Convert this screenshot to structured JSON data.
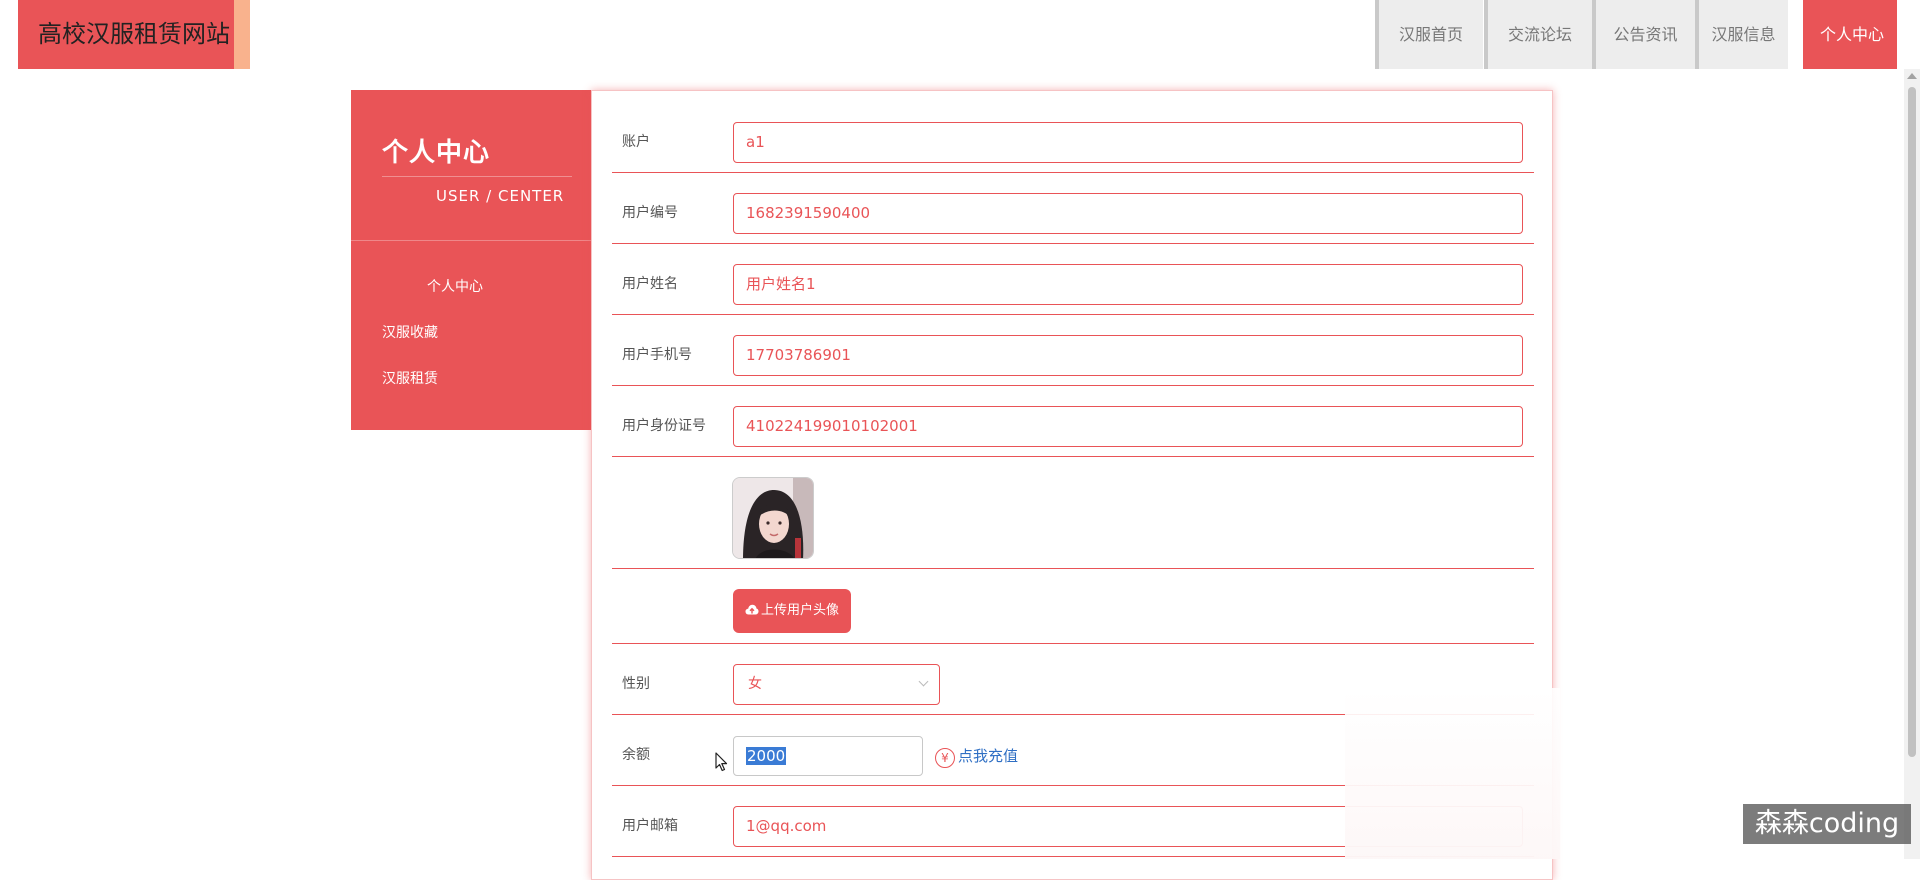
{
  "site": {
    "title": "高校汉服租赁网站"
  },
  "nav": {
    "items": [
      {
        "label": "汉服首页",
        "active": false
      },
      {
        "label": "交流论坛",
        "active": false
      },
      {
        "label": "公告资讯",
        "active": false
      },
      {
        "label": "汉服信息",
        "active": false
      },
      {
        "label": "个人中心",
        "active": true
      }
    ]
  },
  "sidebar": {
    "title": "个人中心",
    "subtitle": "USER / CENTER",
    "links": [
      "个人中心",
      "汉服收藏",
      "汉服租赁"
    ]
  },
  "form": {
    "account": {
      "label": "账户",
      "value": "a1"
    },
    "user_no": {
      "label": "用户编号",
      "value": "1682391590400"
    },
    "user_name": {
      "label": "用户姓名",
      "value": "用户姓名1"
    },
    "phone": {
      "label": "用户手机号",
      "value": "17703786901"
    },
    "id_card": {
      "label": "用户身份证号",
      "value": "410224199010102001"
    },
    "upload_label": "上传用户头像",
    "gender": {
      "label": "性别",
      "value": "女"
    },
    "balance": {
      "label": "余额",
      "value": "2000",
      "recharge": "点我充值"
    },
    "email": {
      "label": "用户邮箱",
      "value": "1@qq.com"
    }
  },
  "watermark": "森森coding",
  "colors": {
    "accent": "#e95457",
    "accent_light": "#f9b28d",
    "link": "#2f6fc4"
  },
  "icons": {
    "upload": "cloud-upload-icon",
    "yen": "yen-circle-icon",
    "pointer": "mouse-cursor-icon",
    "select": "chevron-down-icon"
  }
}
